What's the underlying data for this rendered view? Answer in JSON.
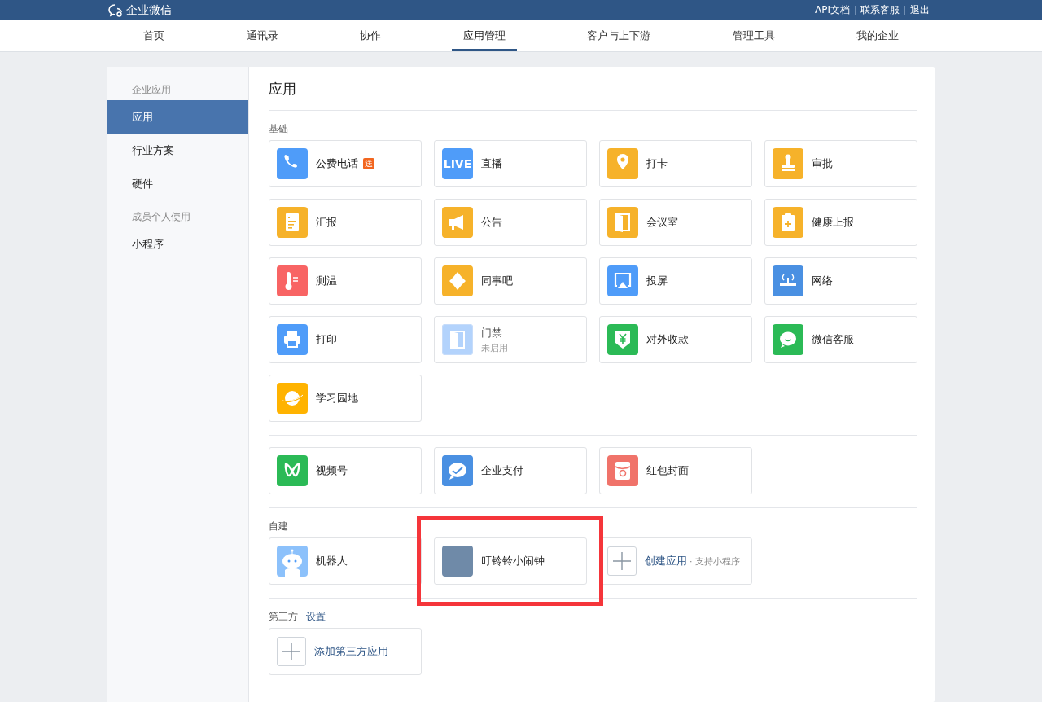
{
  "topbar": {
    "logo": "企业微信",
    "links": [
      "API文档",
      "联系客服",
      "退出"
    ]
  },
  "nav": [
    {
      "label": "首页",
      "selected": false
    },
    {
      "label": "通讯录",
      "selected": false
    },
    {
      "label": "协作",
      "selected": false
    },
    {
      "label": "应用管理",
      "selected": true
    },
    {
      "label": "客户与上下游",
      "selected": false
    },
    {
      "label": "管理工具",
      "selected": false
    },
    {
      "label": "我的企业",
      "selected": false
    }
  ],
  "sidebar": [
    {
      "title": "企业应用",
      "items": [
        {
          "label": "应用",
          "selected": true
        },
        {
          "label": "行业方案",
          "selected": false
        },
        {
          "label": "硬件",
          "selected": false
        }
      ]
    },
    {
      "title": "成员个人使用",
      "items": [
        {
          "label": "小程序",
          "selected": false
        }
      ]
    }
  ],
  "main": {
    "title": "应用",
    "sections": [
      {
        "title": "基础",
        "apps": [
          {
            "kind": "phone",
            "name": "公费电话",
            "badge": "送",
            "color": "#4f9cf9",
            "disabled": false,
            "highlighted": false
          },
          {
            "kind": "live",
            "name": "直播",
            "icon_text": "LIVE",
            "color": "#4f9cf9",
            "disabled": false,
            "highlighted": false
          },
          {
            "kind": "pin",
            "name": "打卡",
            "color": "#f6b22a",
            "disabled": false,
            "highlighted": false
          },
          {
            "kind": "stamp",
            "name": "审批",
            "color": "#f6b22a",
            "disabled": false,
            "highlighted": false
          },
          {
            "kind": "doc",
            "name": "汇报",
            "color": "#f6b22a",
            "disabled": false,
            "highlighted": false
          },
          {
            "kind": "horn",
            "name": "公告",
            "color": "#f6b22a",
            "disabled": false,
            "highlighted": false
          },
          {
            "kind": "door",
            "name": "会议室",
            "color": "#f6b22a",
            "disabled": false,
            "highlighted": false
          },
          {
            "kind": "clipboard",
            "name": "健康上报",
            "color": "#f6b22a",
            "disabled": false,
            "highlighted": false
          },
          {
            "kind": "thermo",
            "name": "测温",
            "color": "#f86464",
            "disabled": false,
            "highlighted": false
          },
          {
            "kind": "nodes",
            "name": "同事吧",
            "color": "#f6b22a",
            "disabled": false,
            "highlighted": false
          },
          {
            "kind": "screen",
            "name": "投屏",
            "color": "#4f9cf9",
            "disabled": false,
            "highlighted": false
          },
          {
            "kind": "router",
            "name": "网络",
            "color": "#4a90e2",
            "disabled": false,
            "highlighted": false
          },
          {
            "kind": "printer",
            "name": "打印",
            "color": "#4f9cf9",
            "disabled": false,
            "highlighted": false
          },
          {
            "kind": "door",
            "name": "门禁",
            "subtitle": "未启用",
            "color": "#b3d3fc",
            "disabled": true,
            "highlighted": false
          },
          {
            "kind": "yuan",
            "name": "对外收款",
            "color": "#2bba56",
            "disabled": false,
            "highlighted": false
          },
          {
            "kind": "chat",
            "name": "微信客服",
            "color": "#2bba56",
            "disabled": false,
            "highlighted": false
          },
          {
            "kind": "planet",
            "name": "学习园地",
            "color": "#ffb300",
            "disabled": false,
            "highlighted": false
          }
        ]
      },
      {
        "apps": [
          {
            "kind": "wave",
            "name": "视频号",
            "color": "#2bba56",
            "disabled": false,
            "highlighted": false
          },
          {
            "kind": "bubble",
            "name": "企业支付",
            "color": "#4a90e2",
            "disabled": false,
            "highlighted": false
          },
          {
            "kind": "envelope",
            "name": "红包封面",
            "color": "#f0736a",
            "disabled": false,
            "highlighted": false
          }
        ]
      },
      {
        "title": "自建",
        "apps": [
          {
            "kind": "robot",
            "name": "机器人",
            "color": "#8cc1fb",
            "disabled": false,
            "highlighted": false
          },
          {
            "kind": "photo",
            "name": "叮铃铃小闹钟",
            "color": "#6f8aa8",
            "disabled": false,
            "highlighted": true
          },
          {
            "kind": "create",
            "name": "创建应用",
            "note": "· 支持小程序",
            "disabled": false,
            "highlighted": false
          }
        ]
      },
      {
        "title": "第三方",
        "link": "设置",
        "apps": [
          {
            "kind": "create",
            "name": "添加第三方应用",
            "disabled": false
          }
        ]
      }
    ]
  }
}
